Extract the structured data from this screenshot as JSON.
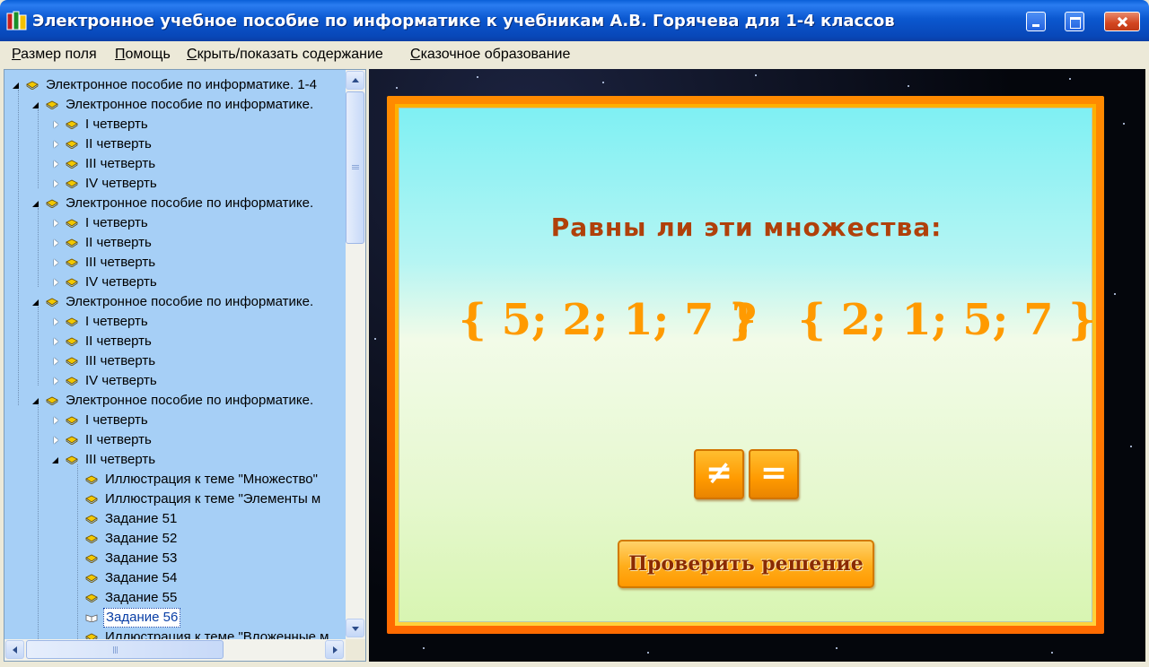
{
  "window": {
    "title": "Электронное учебное пособие по информатике к учебникам А.В. Горячева для 1-4 классов",
    "icon": "books-app-icon",
    "controls": [
      "minimize-icon",
      "maximize-icon",
      "close-icon"
    ]
  },
  "menu": {
    "items": [
      {
        "first": "Р",
        "rest": "азмер поля"
      },
      {
        "first": "П",
        "rest": "омощь"
      },
      {
        "first": "С",
        "rest": "крыть/показать содержание"
      },
      {
        "first": "С",
        "rest": "казочное образование"
      }
    ]
  },
  "tree": {
    "root": "Электронное пособие по информатике. 1-4",
    "grade": "Электронное пособие по информатике.",
    "q1": "I четверть",
    "q2": "II четверть",
    "q3": "III четверть",
    "q4": "IV четверть",
    "leaves": [
      "Иллюстрация к теме \"Множество\"",
      "Иллюстрация к теме \"Элементы м",
      "Задание 51",
      "Задание 52",
      "Задание 53",
      "Задание 54",
      "Задание 55",
      "Задание 56",
      "Иллюстрация к теме \"Вложенные м"
    ],
    "selected": "Задание 56"
  },
  "task": {
    "question": "Равны ли эти множества:",
    "set_a": "{ 5; 2; 1; 7 }",
    "compare": "?",
    "set_b": "{ 2; 1; 5; 7 }",
    "not_equal_label": "≠",
    "equal_label": "=",
    "check_label": "Проверить решение"
  },
  "colors": {
    "title_bar": "#0a5fd8",
    "tree_background": "#a6cff6",
    "frame": "#ff7a00",
    "question_text": "#b0400a",
    "sets_text": "#ff9a00"
  }
}
